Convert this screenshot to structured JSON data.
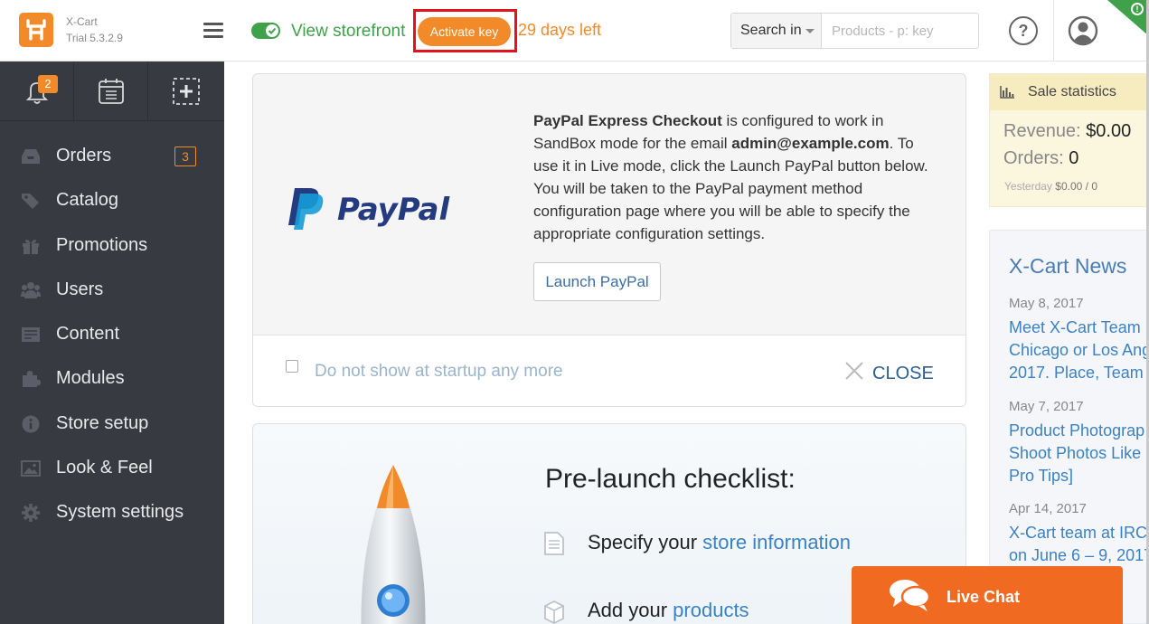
{
  "header": {
    "brand_name": "X-Cart",
    "brand_version": "Trial 5.3.2.9",
    "view_storefront": "View storefront",
    "activate_key": "Activate key",
    "days_left": "29 days left",
    "search_scope": "Search in",
    "search_placeholder": "Products - p: key",
    "help_glyph": "?",
    "corner_mark": "!",
    "storefront_toggle_on": true
  },
  "sidebar": {
    "notifications_count": "2",
    "items": [
      {
        "label": "Orders",
        "icon": "inbox-icon",
        "count": "3"
      },
      {
        "label": "Catalog",
        "icon": "tag-icon"
      },
      {
        "label": "Promotions",
        "icon": "gift-icon"
      },
      {
        "label": "Users",
        "icon": "users-icon"
      },
      {
        "label": "Content",
        "icon": "content-icon"
      },
      {
        "label": "Modules",
        "icon": "puzzle-icon"
      },
      {
        "label": "Store setup",
        "icon": "info-icon"
      },
      {
        "label": "Look & Feel",
        "icon": "image-icon"
      },
      {
        "label": "System settings",
        "icon": "gear-icon"
      }
    ]
  },
  "paypal": {
    "logo_text": "PayPal",
    "product_name": "PayPal Express Checkout",
    "text_part1": " is configured to work in SandBox mode for the email ",
    "email": "admin@example.com",
    "text_part2": ". To use it in Live mode, click the Launch PayPal button below. You will be taken to the PayPal payment method configuration page where you will be able to specify the appropriate configuration settings.",
    "launch_button": "Launch PayPal",
    "dont_show_label": "Do not show at startup any more",
    "close_label": "CLOSE"
  },
  "checklist": {
    "title": "Pre-launch checklist:",
    "rows": [
      {
        "prefix": "Specify your ",
        "link": "store information",
        "icon": "document-icon"
      },
      {
        "prefix": "Add your ",
        "link": "products",
        "icon": "box-icon"
      }
    ]
  },
  "stats": {
    "title": "Sale statistics",
    "revenue_label": "Revenue:",
    "revenue_value": "$0.00",
    "orders_label": "Orders:",
    "orders_value": "0",
    "yesterday_label": "Yesterday",
    "yesterday_revenue": "$0.00",
    "yesterday_sep": "/",
    "yesterday_orders": "0"
  },
  "news": {
    "title": "X-Cart News",
    "items": [
      {
        "date": "May 8, 2017",
        "lines": [
          "Meet X-Cart Team",
          "Chicago or Los Ang",
          "2017. Place, Team"
        ]
      },
      {
        "date": "May 7, 2017",
        "lines": [
          "Product Photograp",
          "Shoot Photos Like",
          "Pro Tips]"
        ]
      },
      {
        "date": "Apr 14, 2017",
        "lines": [
          "X-Cart team at IRCI",
          "on June 6 – 9, 2017"
        ]
      }
    ]
  },
  "livechat": {
    "label": "Live Chat"
  },
  "colors": {
    "accent_orange": "#f28a2a",
    "storefront_green": "#3fa14a",
    "sidebar_bg": "#383a42",
    "link_blue": "#3b82c4",
    "live_chat_orange": "#f06b21",
    "highlight_red": "#e1141e"
  }
}
